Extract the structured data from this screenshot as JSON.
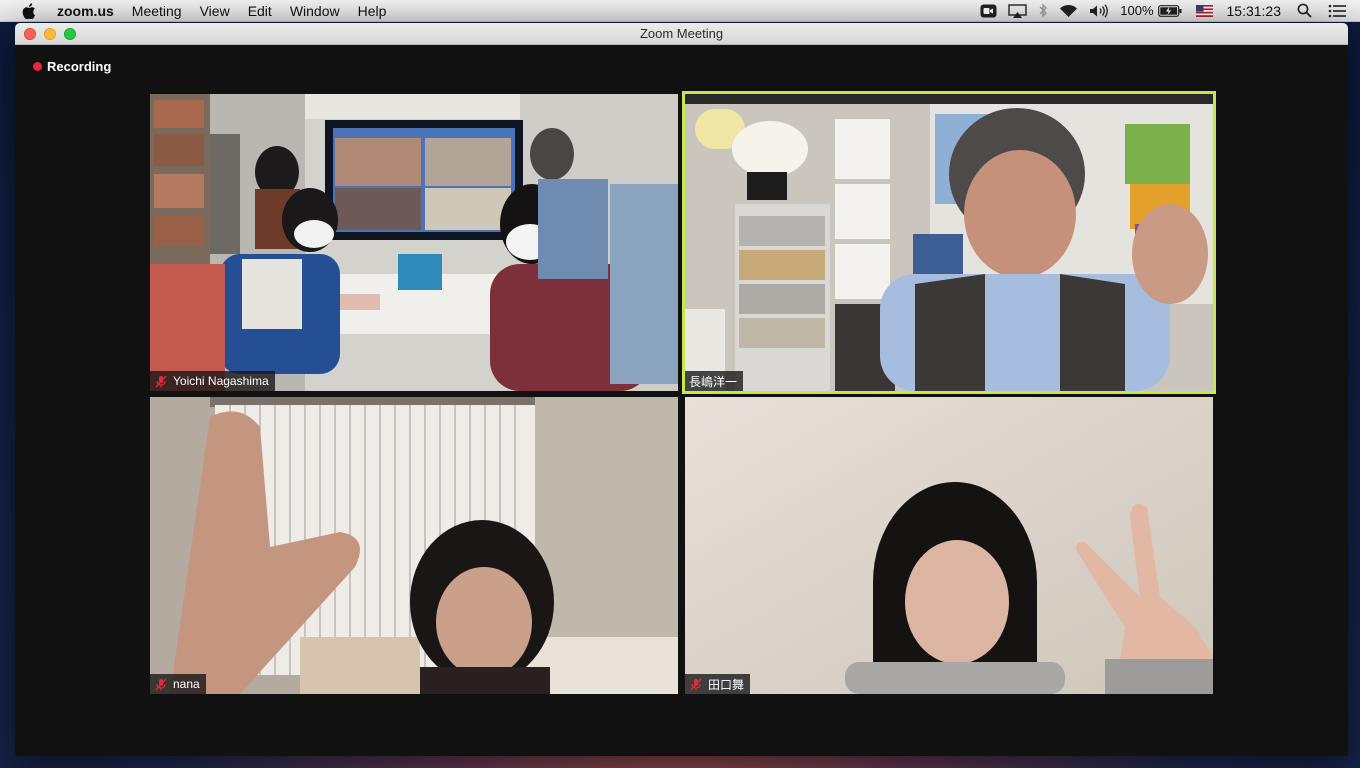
{
  "menubar": {
    "app_name": "zoom.us",
    "menus": [
      "Meeting",
      "View",
      "Edit",
      "Window",
      "Help"
    ],
    "battery_percent": "100%",
    "clock": "15:31:23",
    "icons": [
      "apple-icon",
      "zoom-status-icon",
      "airplay-icon",
      "bluetooth-icon",
      "wifi-icon",
      "volume-icon",
      "battery-icon",
      "flag-us-icon",
      "spotlight-search-icon",
      "notification-center-icon"
    ]
  },
  "window": {
    "title": "Zoom Meeting",
    "recording_label": "Recording"
  },
  "participants": [
    {
      "name": "Yoichi Nagashima",
      "muted": true,
      "active_speaker": false
    },
    {
      "name": "長嶋洋一",
      "muted": false,
      "active_speaker": true
    },
    {
      "name": "nana",
      "muted": true,
      "active_speaker": false
    },
    {
      "name": "田口舞",
      "muted": true,
      "active_speaker": false
    }
  ],
  "colors": {
    "active_speaker_border": "#c8e84a",
    "recording_dot": "#e5283a",
    "muted_mic": "#e5283a"
  }
}
